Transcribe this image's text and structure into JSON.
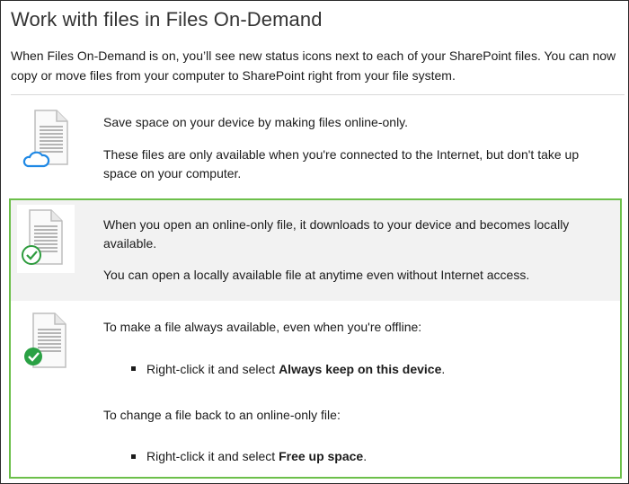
{
  "title": "Work with files in Files On-Demand",
  "intro": "When Files On-Demand is on, you’ll see new status icons next to each of your SharePoint files. You can now copy or move files from your computer to SharePoint right from your file system.",
  "sections": [
    {
      "icon": "online-only-file-icon",
      "lines": [
        "Save space on your device by making files online-only.",
        "These files are only available when you're connected to the Internet, but don't take up space on your computer."
      ]
    },
    {
      "icon": "locally-available-file-icon",
      "lines": [
        "When you open an online-only file, it downloads to your device and becomes locally available.",
        "You can open a locally available file at anytime even without Internet access."
      ]
    },
    {
      "icon": "always-available-file-icon",
      "lines": [
        "To make a file always available, even when you're offline:",
        "To change a file back to an online-only file:"
      ],
      "bullets": [
        {
          "prefix": "Right-click it and select ",
          "bold": "Always keep on this device",
          "suffix": "."
        },
        {
          "prefix": "Right-click it and select ",
          "bold": "Free up space",
          "suffix": "."
        }
      ]
    }
  ],
  "colors": {
    "cloud": "#1e88e5",
    "check_outline": "#2e9c3e",
    "check_fill": "#2aa144",
    "highlight_border": "#6cbf4a",
    "gray_band": "#f2f2f2"
  }
}
